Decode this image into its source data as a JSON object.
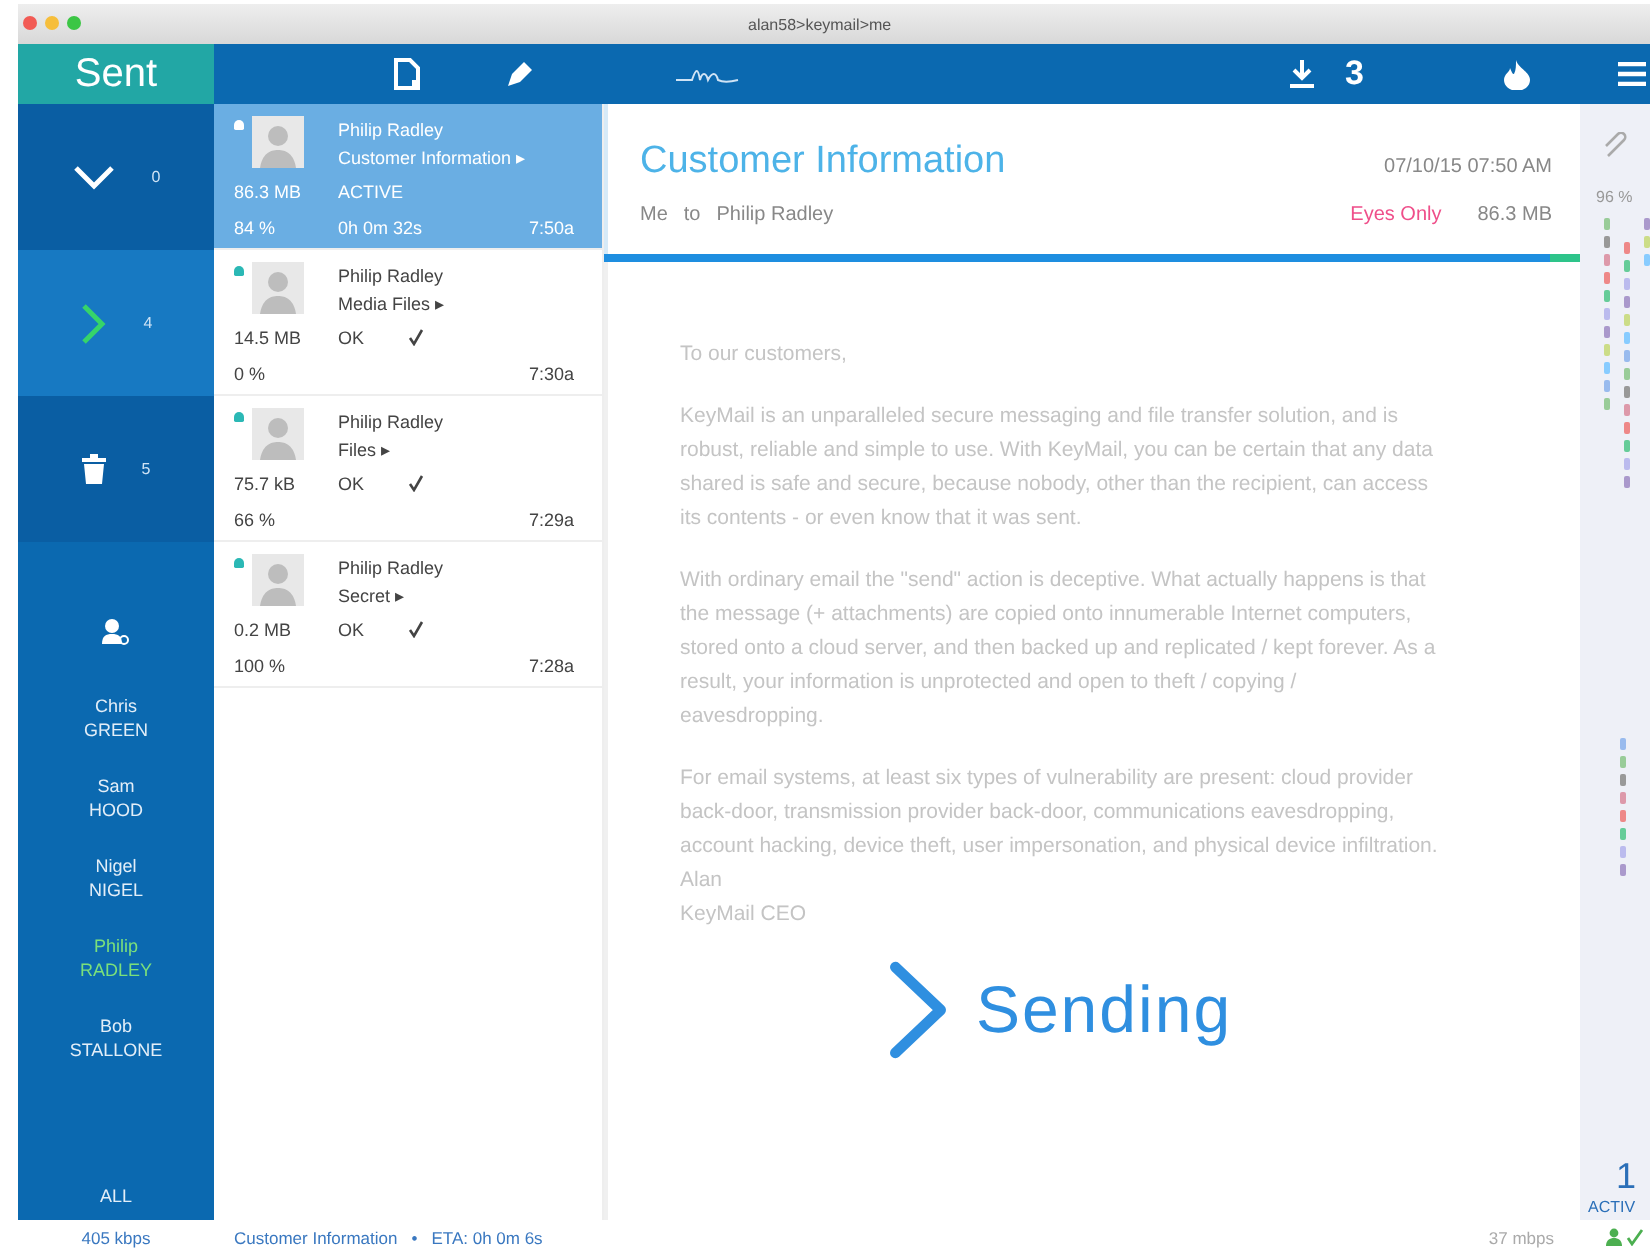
{
  "window": {
    "title": "alan58>keymail>me"
  },
  "toolbar": {
    "folder_title": "Sent",
    "download_count": "3"
  },
  "folders": [
    {
      "kind": "down",
      "count": "0",
      "selected": false
    },
    {
      "kind": "right",
      "count": "4",
      "selected": true
    },
    {
      "kind": "trash",
      "count": "5",
      "selected": false
    }
  ],
  "contacts": [
    {
      "first": "Chris",
      "last": "GREEN",
      "selected": false
    },
    {
      "first": "Sam",
      "last": "HOOD",
      "selected": false
    },
    {
      "first": "Nigel",
      "last": "NIGEL",
      "selected": false
    },
    {
      "first": "Philip",
      "last": "RADLEY",
      "selected": true
    },
    {
      "first": "Bob",
      "last": "STALLONE",
      "selected": false
    }
  ],
  "contacts_all": "ALL",
  "messages": [
    {
      "name": "Philip Radley",
      "subject": "Customer Information ▸",
      "size": "86.3 MB",
      "status": "ACTIVE",
      "confirmed": false,
      "percent": "84 %",
      "eta": "0h 0m 32s",
      "time": "7:50a",
      "selected": true
    },
    {
      "name": "Philip Radley",
      "subject": "Media Files ▸",
      "size": "14.5 MB",
      "status": "OK",
      "confirmed": true,
      "percent": "0 %",
      "time": "7:30a",
      "selected": false
    },
    {
      "name": "Philip Radley",
      "subject": "Files ▸",
      "size": "75.7 kB",
      "status": "OK",
      "confirmed": true,
      "percent": "66 %",
      "time": "7:29a",
      "selected": false
    },
    {
      "name": "Philip Radley",
      "subject": "Secret ▸",
      "size": "0.2 MB",
      "status": "OK",
      "confirmed": true,
      "percent": "100 %",
      "time": "7:28a",
      "selected": false
    }
  ],
  "reader": {
    "title": "Customer Information",
    "datetime": "07/10/15  07:50 AM",
    "from": "Me",
    "to_word": "to",
    "to": "Philip Radley",
    "security": "Eyes Only",
    "size": "86.3 MB",
    "level": 0.97,
    "body": [
      "To our customers,",
      "KeyMail is an unparalleled secure messaging and file transfer solution, and is robust, reliable and simple to use. With KeyMail, you can be certain that any data shared is safe and secure, because nobody, other than the recipient, can access its contents - or even know that it was sent.",
      "With ordinary email the \"send\" action is deceptive. What actually happens is that the message (+ attachments) are copied onto innumerable Internet computers, stored onto a cloud server, and then backed up and replicated / kept forever. As a result, your information is unprotected and open to theft / copying / eavesdropping.",
      "For email systems, at least six types of vulnerability are present: cloud provider back-door, transmission provider back-door, communications eavesdropping, account hacking, device theft, user impersonation, and physical device infiltration.\nAlan\nKeyMail CEO"
    ],
    "overlay": "Sending"
  },
  "side_panel": {
    "percent": "96 %",
    "active_count": "1",
    "active_label": "ACTIV"
  },
  "status_bar": {
    "speed_in": "405 kbps",
    "current": "Customer Information",
    "separator": "•",
    "eta": "ETA: 0h 0m 6s",
    "speed_out": "37 mbps"
  }
}
